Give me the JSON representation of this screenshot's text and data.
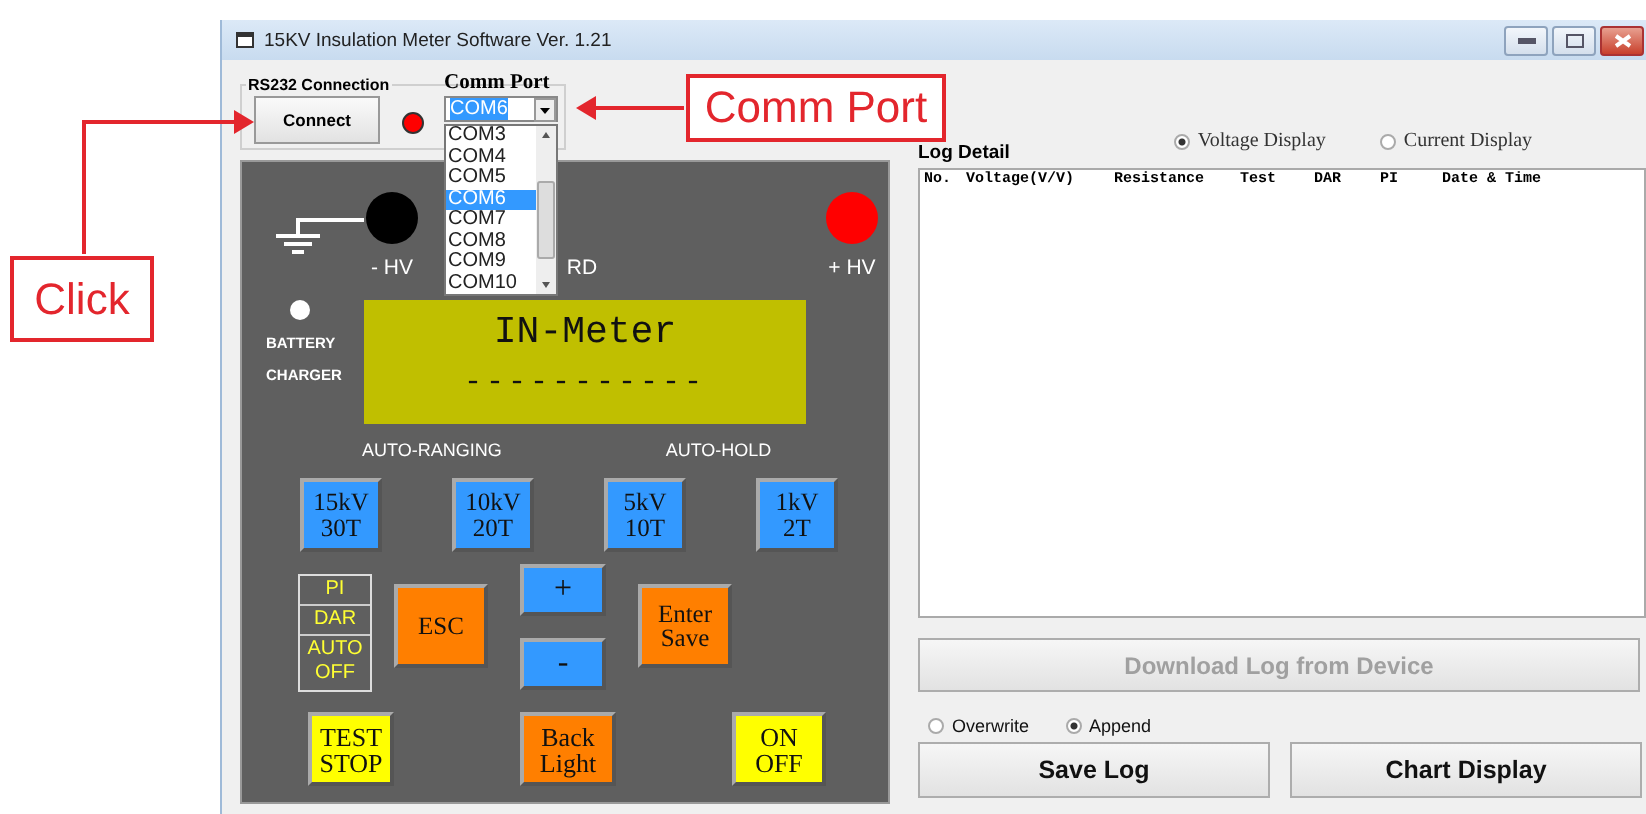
{
  "window": {
    "title": "15KV Insulation Meter Software Ver. 1.21"
  },
  "connection": {
    "group_label": "RS232 Connection",
    "connect_button": "Connect",
    "connected": false,
    "comm_port": {
      "label": "Comm Port",
      "value": "COM6",
      "items": [
        {
          "label": "COM3",
          "selected": false
        },
        {
          "label": "COM4",
          "selected": false
        },
        {
          "label": "COM5",
          "selected": false
        },
        {
          "label": "COM6",
          "selected": true
        },
        {
          "label": "COM7",
          "selected": false
        },
        {
          "label": "COM8",
          "selected": false
        },
        {
          "label": "COM9",
          "selected": false
        },
        {
          "label": "COM10",
          "selected": false
        }
      ]
    }
  },
  "meter": {
    "terminals": [
      {
        "kind": "negative",
        "label": "- HV"
      },
      {
        "kind": "guard",
        "label": "RD"
      },
      {
        "kind": "positive",
        "label": "+ HV"
      }
    ],
    "battery_labels": [
      "BATTERY",
      "CHARGER"
    ],
    "lcd": {
      "title": "IN-Meter",
      "reading": "-----------"
    },
    "indicators": [
      "AUTO-RANGING",
      "AUTO-HOLD"
    ],
    "range_keys": [
      {
        "lines": [
          "15kV",
          "30T"
        ]
      },
      {
        "lines": [
          "10kV",
          "20T"
        ]
      },
      {
        "lines": [
          "5kV",
          "10T"
        ]
      },
      {
        "lines": [
          "1kV",
          "2T"
        ]
      }
    ],
    "modes": [
      "PI",
      "DAR",
      "AUTO OFF"
    ],
    "esc_key": "ESC",
    "plus_key": "+",
    "minus_key": "-",
    "enter_key": [
      "Enter",
      "Save"
    ],
    "bottom_keys": [
      {
        "lines": [
          "TEST",
          "STOP"
        ],
        "color": "#ffff00"
      },
      {
        "lines": [
          "Back",
          "Light"
        ],
        "color": "#ff7f00"
      },
      {
        "lines": [
          "ON",
          "OFF"
        ],
        "color": "#ffff00"
      }
    ]
  },
  "log": {
    "label": "Log Detail",
    "display_options": [
      {
        "label": "Voltage Display",
        "selected": true
      },
      {
        "label": "Current Display",
        "selected": false
      }
    ],
    "columns": [
      "No.",
      "Voltage(V/V)",
      "Resistance",
      "Test",
      "DAR",
      "PI",
      "Date & Time"
    ],
    "download_button": {
      "label": "Download Log from Device",
      "disabled": true
    },
    "save_modes": [
      {
        "label": "Overwrite",
        "selected": false
      },
      {
        "label": "Append",
        "selected": true
      }
    ],
    "buttons": [
      "Save Log",
      "Chart Display"
    ]
  },
  "annotations": [
    {
      "kind": "click",
      "label": "Click"
    },
    {
      "kind": "port",
      "label": "Comm Port"
    }
  ]
}
